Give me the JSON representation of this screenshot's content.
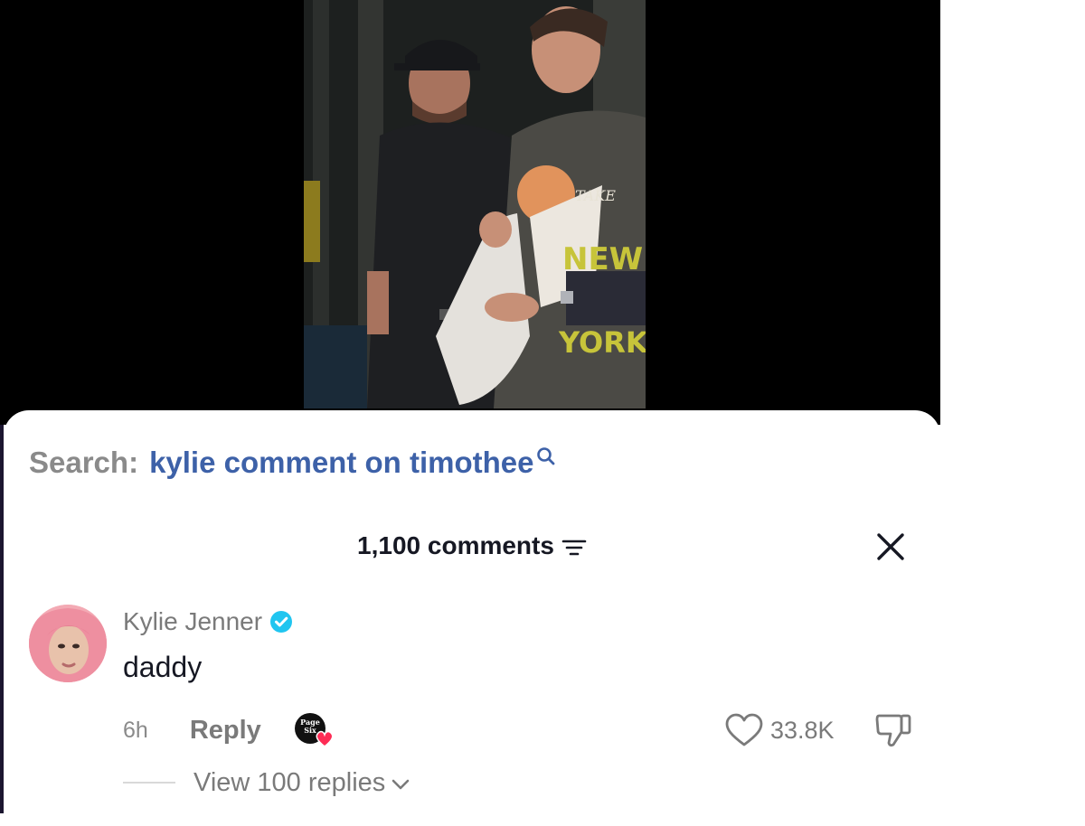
{
  "video": {
    "description_icon": "video-still",
    "background_color": "#000000"
  },
  "search": {
    "label": "Search:",
    "query": "kylie comment on timothee",
    "icon": "search-icon",
    "query_color": "#3d61a8"
  },
  "comments_panel": {
    "count_label": "1,100 comments",
    "filter_icon": "filter-icon",
    "close_icon": "close-icon"
  },
  "comments": [
    {
      "author": "Kylie Jenner",
      "verified": true,
      "verified_color": "#20c5f0",
      "text": "daddy",
      "age": "6h",
      "reply_label": "Reply",
      "creator_badge": "liked-by-creator-badge",
      "like_count": "33.8K",
      "view_replies_label": "View 100 replies"
    }
  ]
}
